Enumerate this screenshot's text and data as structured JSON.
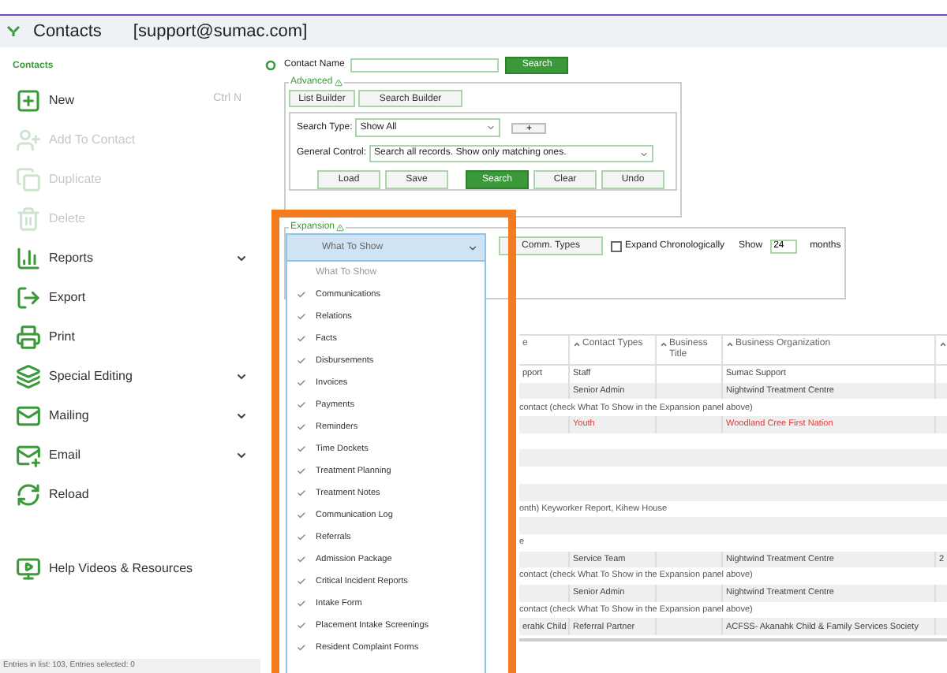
{
  "window": {
    "title": "Contacts",
    "account": "[support@sumac.com]"
  },
  "sidebar": {
    "heading": "Contacts",
    "items": [
      {
        "label": "New",
        "shortcut": "Ctrl N",
        "disabled": false,
        "expandable": false
      },
      {
        "label": "Add To Contact",
        "disabled": true,
        "expandable": false
      },
      {
        "label": "Duplicate",
        "disabled": true,
        "expandable": false
      },
      {
        "label": "Delete",
        "disabled": true,
        "expandable": false
      },
      {
        "label": "Reports",
        "disabled": false,
        "expandable": true
      },
      {
        "label": "Export",
        "disabled": false,
        "expandable": false
      },
      {
        "label": "Print",
        "disabled": false,
        "expandable": false
      },
      {
        "label": "Special Editing",
        "disabled": false,
        "expandable": true
      },
      {
        "label": "Mailing",
        "disabled": false,
        "expandable": true
      },
      {
        "label": "Email",
        "disabled": false,
        "expandable": true
      },
      {
        "label": "Reload",
        "disabled": false,
        "expandable": false
      },
      {
        "label": "Help Videos & Resources",
        "disabled": false,
        "expandable": false
      }
    ]
  },
  "contact_name": {
    "label": "Contact Name",
    "button": "Search"
  },
  "advanced": {
    "legend": "Advanced",
    "builders": [
      "List Builder",
      "Search Builder"
    ],
    "search_type": {
      "label": "Search Type:",
      "value": "Show All",
      "add": "+"
    },
    "general_control": {
      "label": "General Control:",
      "value": "Search all records. Show only matching ones."
    },
    "buttons": [
      {
        "label": "Load",
        "primary": false
      },
      {
        "label": "Save",
        "primary": false
      },
      {
        "label": "Search",
        "primary": true
      },
      {
        "label": "Clear",
        "primary": false
      },
      {
        "label": "Undo",
        "primary": false
      }
    ]
  },
  "expansion": {
    "legend": "Expansion",
    "comm_types": "Comm. Types",
    "expand_chronologically": {
      "label": "Expand Chronologically",
      "checked": false
    },
    "show_label": "Show",
    "months_value": "24",
    "months_label": "months"
  },
  "what_to_show": {
    "value": "What To Show",
    "header": "What To Show",
    "options": [
      {
        "label": "Communications",
        "checked": true
      },
      {
        "label": "Relations",
        "checked": true
      },
      {
        "label": "Facts",
        "checked": true
      },
      {
        "label": "Disbursements",
        "checked": true
      },
      {
        "label": "Invoices",
        "checked": true
      },
      {
        "label": "Payments",
        "checked": true
      },
      {
        "label": "Reminders",
        "checked": true
      },
      {
        "label": "Time Dockets",
        "checked": true
      },
      {
        "label": "Treatment Planning",
        "checked": true
      },
      {
        "label": "Treatment Notes",
        "checked": true
      },
      {
        "label": "Communication Log",
        "checked": true
      },
      {
        "label": "Referrals",
        "checked": true
      },
      {
        "label": "Admission Package",
        "checked": true
      },
      {
        "label": "Critical Incident Reports",
        "checked": true
      },
      {
        "label": "Intake Form",
        "checked": true
      },
      {
        "label": "Placement Intake Screenings",
        "checked": true
      },
      {
        "label": "Resident Complaint Forms",
        "checked": true
      }
    ]
  },
  "table": {
    "columns": [
      "e",
      "Contact Types",
      "Business Title",
      "Business Organization",
      ""
    ],
    "rows": [
      {
        "kind": "record",
        "cells": [
          "pport",
          "Staff",
          "",
          "Sumac Support",
          ""
        ]
      },
      {
        "kind": "record",
        "cells": [
          "",
          "Senior Admin",
          "",
          "Nightwind Treatment Centre",
          ""
        ]
      },
      {
        "kind": "note",
        "text": "contact (check What To Show in the Expansion panel above)"
      },
      {
        "kind": "record",
        "color": "#e53935",
        "cells": [
          "",
          "Youth",
          "",
          "Woodland Cree First Nation",
          ""
        ]
      },
      {
        "kind": "blank"
      },
      {
        "kind": "blank"
      },
      {
        "kind": "blank"
      },
      {
        "kind": "blank"
      },
      {
        "kind": "note",
        "text": "onth) Keyworker Report, Kihew House"
      },
      {
        "kind": "blank"
      },
      {
        "kind": "note",
        "text": "e"
      },
      {
        "kind": "record",
        "cells": [
          "",
          "Service Team",
          "",
          "Nightwind Treatment Centre",
          "2"
        ]
      },
      {
        "kind": "note",
        "text": "contact (check What To Show in the Expansion panel above)"
      },
      {
        "kind": "record",
        "cells": [
          "",
          "Senior Admin",
          "",
          "Nightwind Treatment Centre",
          ""
        ]
      },
      {
        "kind": "note",
        "text": "contact (check What To Show in the Expansion panel above)"
      },
      {
        "kind": "record",
        "cells": [
          "erahk Child",
          "Referral Partner",
          "",
          "ACFSS- Akanahk Child & Family Services Society",
          ""
        ]
      }
    ]
  },
  "status_bar": "Entries in list: 103, Entries selected: 0"
}
